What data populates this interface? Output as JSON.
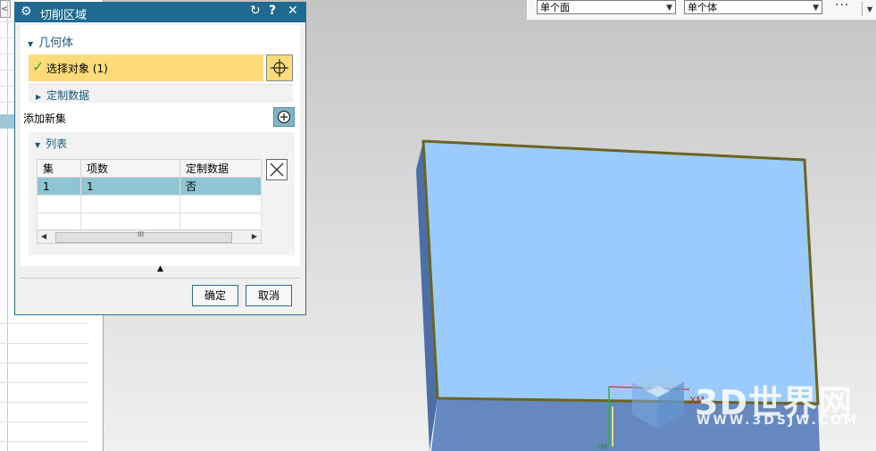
{
  "dialog": {
    "title": "切削区域",
    "reset_icon": "reset-icon",
    "help_label": "?",
    "close_label": "✕",
    "geometry_section": "几何体",
    "select_object_label": "选择对象 (1)",
    "custom_data_label": "定制数据",
    "add_new_set_label": "添加新集",
    "list_section": "列表",
    "table": {
      "headers": [
        "集",
        "项数",
        "定制数据"
      ],
      "rows": [
        [
          "1",
          "1",
          "否"
        ]
      ]
    },
    "scroll_thumb_mark": "III",
    "ok_label": "确定",
    "cancel_label": "取消"
  },
  "toolbar": {
    "face_filter": "单个面",
    "body_filter": "单个体",
    "more_label": "···"
  },
  "viewport": {
    "axis_label": "XM",
    "axis_label_small": "YM"
  },
  "watermark": {
    "brand": "3D世界网",
    "url": "WWW.3DSJW.COM"
  },
  "colors": {
    "title_bar": "#1e6a90",
    "selection_highlight": "#fedb7a",
    "table_selected_row": "#8fc4d3",
    "model_top_face": "#9bcbfc",
    "model_front_face": "#6588c0",
    "model_edge": "#6b6520"
  }
}
